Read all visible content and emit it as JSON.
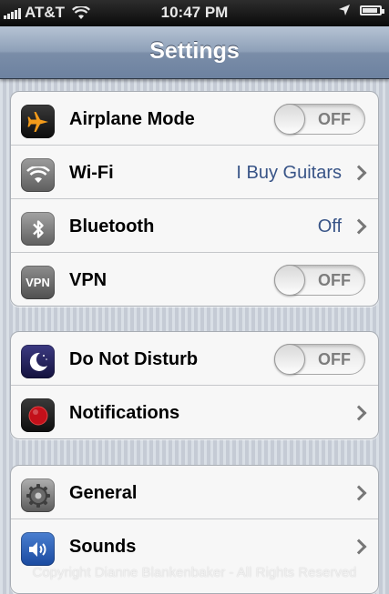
{
  "status_bar": {
    "carrier": "AT&T",
    "time": "10:47 PM",
    "wifi_icon": "wifi-icon",
    "location_icon": "location-arrow-icon",
    "battery_level": 0.9
  },
  "navbar": {
    "title": "Settings"
  },
  "groups": [
    {
      "rows": [
        {
          "label": "Airplane Mode",
          "icon": "airplane-icon",
          "toggle": "OFF"
        },
        {
          "label": "Wi-Fi",
          "icon": "wifi-icon",
          "value": "I Buy Guitars"
        },
        {
          "label": "Bluetooth",
          "icon": "bluetooth-icon",
          "value": "Off"
        },
        {
          "label": "VPN",
          "icon": "vpn-icon",
          "icon_text": "VPN",
          "toggle": "OFF"
        }
      ]
    },
    {
      "rows": [
        {
          "label": "Do Not Disturb",
          "icon": "moon-icon",
          "toggle": "OFF"
        },
        {
          "label": "Notifications",
          "icon": "notifications-icon"
        }
      ]
    },
    {
      "rows": [
        {
          "label": "General",
          "icon": "gear-icon"
        },
        {
          "label": "Sounds",
          "icon": "speaker-icon"
        }
      ]
    }
  ],
  "watermark": "Copyright Dianne Blankenbaker - All Rights Reserved"
}
